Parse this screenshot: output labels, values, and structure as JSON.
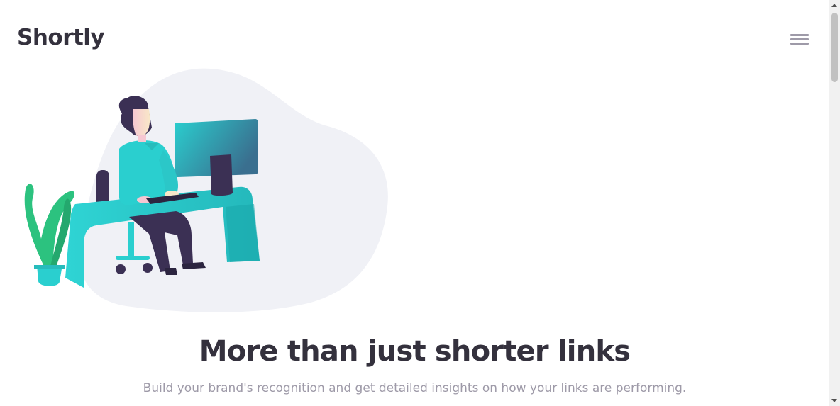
{
  "header": {
    "logo_text": "Shortly",
    "menu_icon": "hamburger-menu-icon"
  },
  "hero": {
    "illustration": "person-working-at-desk-illustration",
    "title": "More than just shorter links",
    "subtitle": "Build your brand's recognition and get detailed insights on how your links are performing."
  },
  "colors": {
    "text_dark": "#34313d",
    "text_gray": "#9e9aa8",
    "cyan": "#2acfcf",
    "blob_background": "#f0f1f6",
    "purple": "#3b3054",
    "plant_green": "#33c48d"
  }
}
